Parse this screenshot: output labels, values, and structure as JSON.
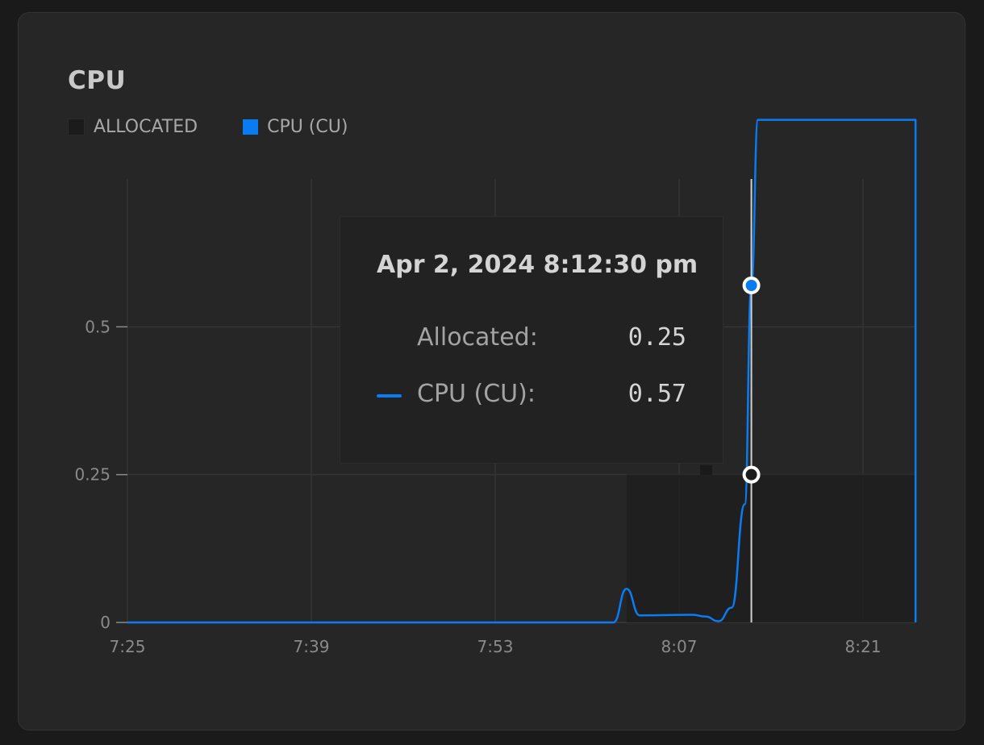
{
  "card": {
    "title": "CPU"
  },
  "legend": [
    {
      "label": "ALLOCATED",
      "color": "#1b1b1b"
    },
    {
      "label": "CPU (CU)",
      "color": "#0a7cf3"
    }
  ],
  "tooltip": {
    "date": "Apr 2, 2024 8:12:30 pm",
    "rows": [
      {
        "label": "Allocated:",
        "value": "0.25",
        "marker": "none"
      },
      {
        "label": "CPU (CU):",
        "value": "0.57",
        "marker": "line",
        "color": "#0a7cf3"
      }
    ]
  },
  "colors": {
    "background": "#1a1a1a",
    "card": "#262626",
    "grid": "#353535",
    "cpu_line": "#0a7cf3",
    "allocated_fill": "#1e1e1e",
    "cursor": "#d0d0d0"
  },
  "chart_data": {
    "type": "line",
    "title": "CPU",
    "xlabel": "",
    "ylabel": "",
    "x_tick_labels": [
      "7:25",
      "7:39",
      "7:53",
      "8:07",
      "8:21"
    ],
    "y_tick_labels": [
      "0",
      "0.25",
      "0.5"
    ],
    "y_ticks": [
      0,
      0.25,
      0.5
    ],
    "grid": true,
    "legend_position": "top-left",
    "series": [
      {
        "name": "ALLOCATED",
        "type": "area",
        "points": [
          {
            "x": "8:03",
            "y": 0.25
          },
          {
            "x": "8:25",
            "y": 0.25
          }
        ]
      },
      {
        "name": "CPU (CU)",
        "type": "line",
        "points": [
          {
            "x": "7:25",
            "y": 0
          },
          {
            "x": "8:02",
            "y": 0
          },
          {
            "x": "8:03",
            "y": 0.057
          },
          {
            "x": "8:04",
            "y": 0.012
          },
          {
            "x": "8:08",
            "y": 0.013
          },
          {
            "x": "8:09",
            "y": 0.01
          },
          {
            "x": "8:10",
            "y": 0.002
          },
          {
            "x": "8:11",
            "y": 0.025
          },
          {
            "x": "8:12",
            "y": 0.2
          },
          {
            "x": "8:12:30",
            "y": 0.57
          },
          {
            "x": "8:13",
            "y": 0.85
          },
          {
            "x": "8:25",
            "y": 0.85
          },
          {
            "x": "8:25",
            "y": 0
          }
        ]
      }
    ],
    "cursor": {
      "x": "8:12:30",
      "values": {
        "ALLOCATED": 0.25,
        "CPU (CU)": 0.57
      }
    }
  }
}
